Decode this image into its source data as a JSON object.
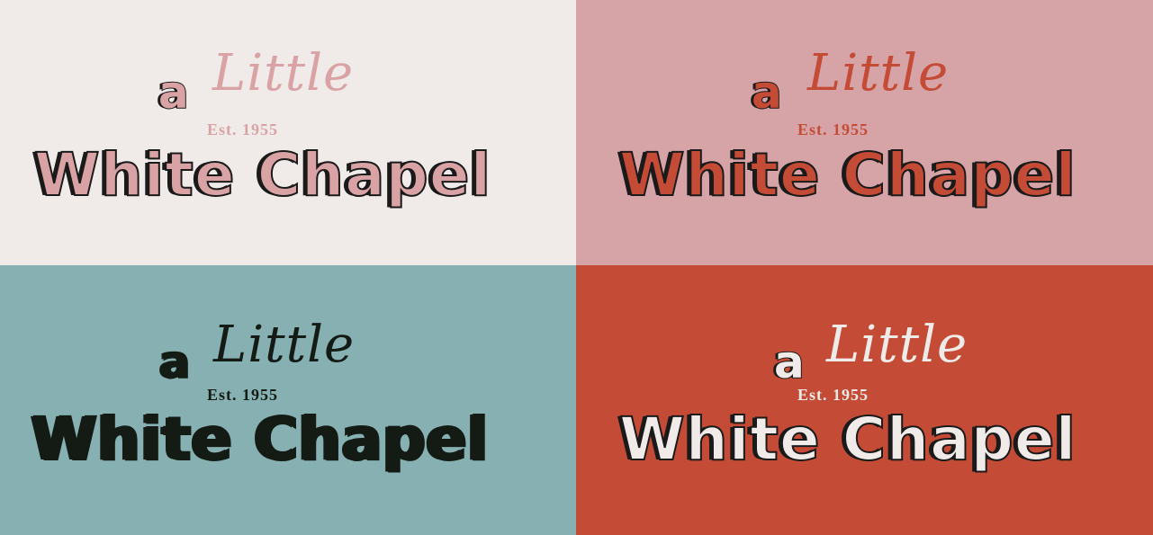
{
  "panels": [
    {
      "a": "a",
      "little": "Little",
      "est": "Est. 1955",
      "name": "White Chapel",
      "colors": {
        "bg": "#f0ebe8",
        "fill": "#d9a3a5",
        "outline": "#1a1a1a",
        "script": "#d9a3a5",
        "est": "#d9a3a5"
      }
    },
    {
      "a": "a",
      "little": "Little",
      "est": "Est. 1955",
      "name": "White Chapel",
      "colors": {
        "bg": "#d6a4a7",
        "fill": "#c44b36",
        "outline": "#1a1a1a",
        "script": "#c44b36",
        "est": "#c44b36"
      }
    },
    {
      "a": "a",
      "little": "Little",
      "est": "Est. 1955",
      "name": "White Chapel",
      "colors": {
        "bg": "#86b0b2",
        "fill": "#141a14",
        "outline": "#141a14",
        "script": "#141a14",
        "est": "#141a14"
      }
    },
    {
      "a": "a",
      "little": "Little",
      "est": "Est. 1955",
      "name": "White Chapel",
      "colors": {
        "bg": "#c44b36",
        "fill": "#f0ebe8",
        "outline": "#1a1a1a",
        "script": "#f0ebe8",
        "est": "#f0ebe8"
      }
    }
  ]
}
